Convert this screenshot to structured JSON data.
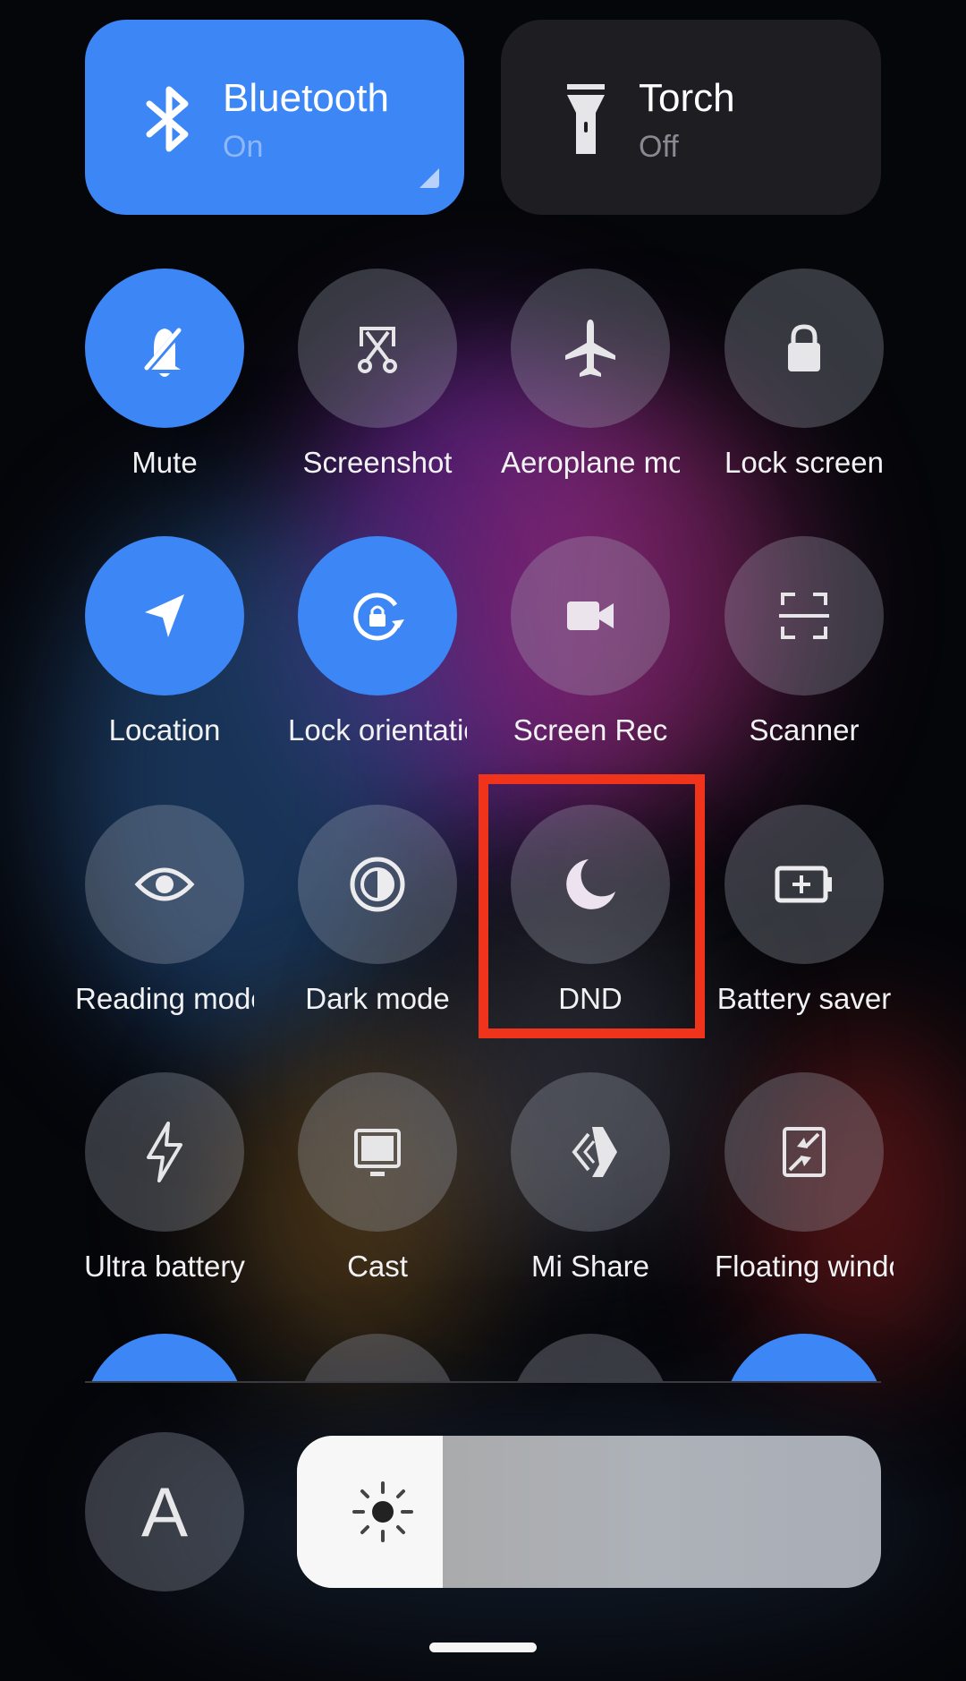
{
  "tiles": {
    "bluetooth": {
      "title": "Bluetooth",
      "status": "On",
      "icon": "bluetooth-icon",
      "active": true
    },
    "torch": {
      "title": "Torch",
      "status": "Off",
      "icon": "flashlight-icon",
      "active": false
    }
  },
  "toggles": [
    {
      "label": "Mute",
      "icon": "bell-off-icon",
      "active": true
    },
    {
      "label": "Screenshot",
      "icon": "scissors-icon",
      "active": false
    },
    {
      "label": "Aeroplane mode",
      "icon": "airplane-icon",
      "active": false
    },
    {
      "label": "Lock screen",
      "icon": "lock-icon",
      "active": false
    },
    {
      "label": "Location",
      "icon": "location-arrow-icon",
      "active": true
    },
    {
      "label": "Lock orientation",
      "icon": "rotation-lock-icon",
      "active": true
    },
    {
      "label": "Screen Rec",
      "icon": "video-camera-icon",
      "active": false
    },
    {
      "label": "Scanner",
      "icon": "scan-frame-icon",
      "active": false
    },
    {
      "label": "Reading mode",
      "icon": "eye-icon",
      "active": false
    },
    {
      "label": "Dark mode",
      "icon": "contrast-icon",
      "active": false
    },
    {
      "label": "DND",
      "icon": "moon-icon",
      "active": false,
      "highlighted": true
    },
    {
      "label": "Battery saver",
      "icon": "battery-plus-icon",
      "active": false
    },
    {
      "label": "Ultra battery",
      "icon": "lightning-icon",
      "active": false
    },
    {
      "label": "Cast",
      "icon": "monitor-icon",
      "active": false
    },
    {
      "label": "Mi Share",
      "icon": "mi-share-icon",
      "active": false
    },
    {
      "label": "Floating window",
      "icon": "floating-window-icon",
      "active": false
    }
  ],
  "partial_row": [
    {
      "active": true
    },
    {
      "active": false
    },
    {
      "active": false
    },
    {
      "active": true
    }
  ],
  "auto_brightness": {
    "label": "A",
    "icon": "auto-brightness-icon"
  },
  "brightness": {
    "level_percent": 25,
    "icon": "sun-icon"
  },
  "colors": {
    "accent": "#3d86f5",
    "highlight_box": "#f0331b"
  }
}
